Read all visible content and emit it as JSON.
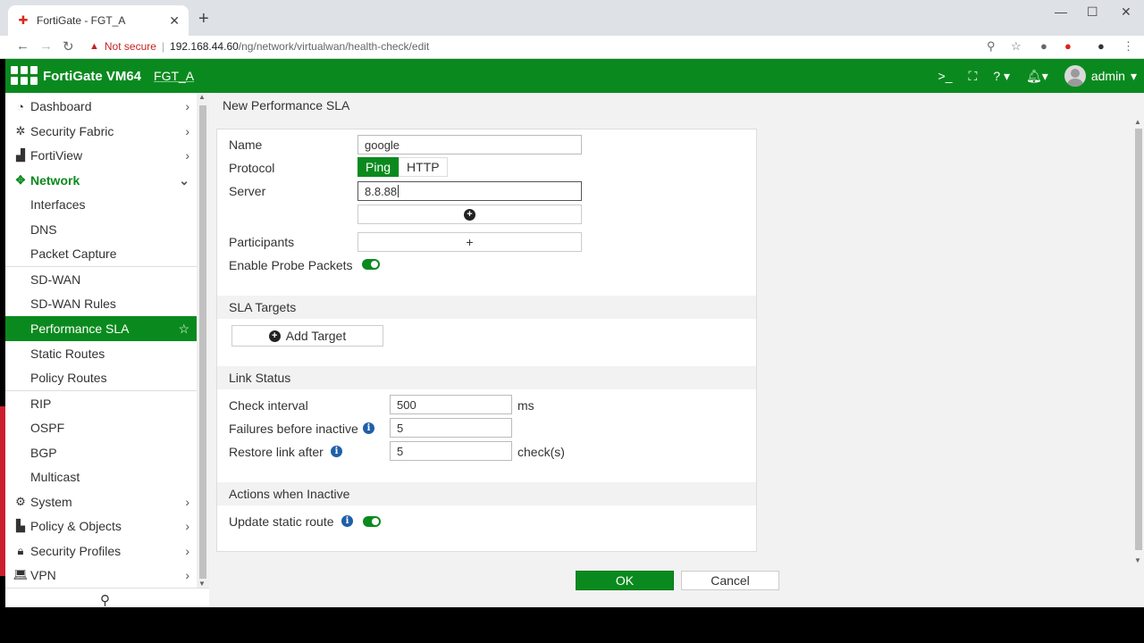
{
  "browser": {
    "tab_title": "FortiGate - FGT_A",
    "not_secure": "Not secure",
    "url_host": "192.168.44.60",
    "url_path": "/ng/network/virtualwan/health-check/edit"
  },
  "header": {
    "product": "FortiGate VM64",
    "hostname": "FGT_A",
    "user": "admin"
  },
  "sidebar": {
    "items": [
      {
        "label": "Dashboard",
        "icon": "dashboard-icon"
      },
      {
        "label": "Security Fabric",
        "icon": "fabric-icon"
      },
      {
        "label": "FortiView",
        "icon": "chart-icon"
      },
      {
        "label": "Network",
        "icon": "network-icon"
      },
      {
        "label": "Interfaces"
      },
      {
        "label": "DNS"
      },
      {
        "label": "Packet Capture"
      },
      {
        "label": "SD-WAN"
      },
      {
        "label": "SD-WAN Rules"
      },
      {
        "label": "Performance SLA"
      },
      {
        "label": "Static Routes"
      },
      {
        "label": "Policy Routes"
      },
      {
        "label": "RIP"
      },
      {
        "label": "OSPF"
      },
      {
        "label": "BGP"
      },
      {
        "label": "Multicast"
      },
      {
        "label": "System",
        "icon": "gear-icon"
      },
      {
        "label": "Policy & Objects",
        "icon": "policy-icon"
      },
      {
        "label": "Security Profiles",
        "icon": "lock-icon"
      },
      {
        "label": "VPN",
        "icon": "laptop-icon"
      }
    ]
  },
  "page": {
    "title": "New Performance SLA",
    "name_label": "Name",
    "name_value": "google",
    "protocol_label": "Protocol",
    "protocol_options": [
      "Ping",
      "HTTP"
    ],
    "protocol_selected": "Ping",
    "server_label": "Server",
    "server_value": "8.8.88",
    "participants_label": "Participants",
    "participants_add": "+",
    "probe_label": "Enable Probe Packets",
    "sla_targets_heading": "SLA Targets",
    "add_target_label": "Add Target",
    "link_status_heading": "Link Status",
    "check_interval_label": "Check interval",
    "check_interval_value": "500",
    "check_interval_unit": "ms",
    "failures_label": "Failures before inactive",
    "failures_value": "5",
    "restore_label": "Restore link after",
    "restore_value": "5",
    "restore_unit": "check(s)",
    "actions_heading": "Actions when Inactive",
    "update_route_label": "Update static route",
    "ok_label": "OK",
    "cancel_label": "Cancel"
  },
  "colors": {
    "brand_green": "#0a8a1e",
    "info_blue": "#1f5fa8"
  }
}
